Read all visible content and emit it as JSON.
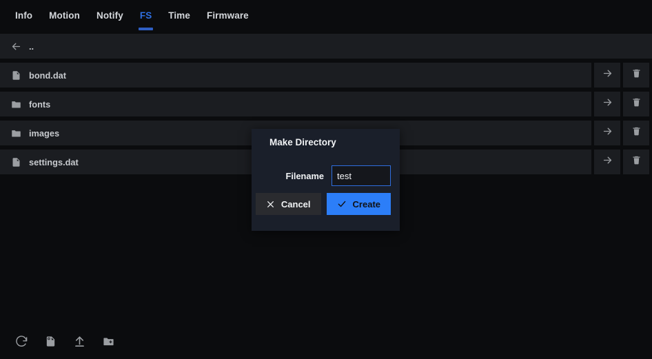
{
  "tabs": [
    {
      "label": "Info",
      "active": false
    },
    {
      "label": "Motion",
      "active": false
    },
    {
      "label": "Notify",
      "active": false
    },
    {
      "label": "FS",
      "active": true
    },
    {
      "label": "Time",
      "active": false
    },
    {
      "label": "Firmware",
      "active": false
    }
  ],
  "filelist": {
    "rows": [
      {
        "name": "..",
        "icon": "back-arrow-icon",
        "type": "parent",
        "actions": false
      },
      {
        "name": "bond.dat",
        "icon": "file-icon",
        "type": "file",
        "actions": true
      },
      {
        "name": "fonts",
        "icon": "folder-icon",
        "type": "folder",
        "actions": true
      },
      {
        "name": "images",
        "icon": "folder-icon",
        "type": "folder",
        "actions": true
      },
      {
        "name": "settings.dat",
        "icon": "file-icon",
        "type": "file",
        "actions": true
      }
    ],
    "action_icons": {
      "open": "arrow-right-icon",
      "delete": "trash-icon"
    }
  },
  "toolbar": {
    "buttons": [
      {
        "icon": "refresh-icon",
        "name": "refresh-button"
      },
      {
        "icon": "new-file-icon",
        "name": "new-file-button"
      },
      {
        "icon": "upload-icon",
        "name": "upload-button"
      },
      {
        "icon": "new-folder-icon",
        "name": "new-folder-button"
      }
    ]
  },
  "modal": {
    "title": "Make Directory",
    "filename_label": "Filename",
    "filename_value": "test",
    "filename_placeholder": "",
    "cancel_label": "Cancel",
    "create_label": "Create",
    "cancel_icon": "close-x-icon",
    "create_icon": "check-icon"
  },
  "colors": {
    "page_bg": "#0b0c0e",
    "row_bg": "#1b1d21",
    "accent_blue": "#2f6fe0",
    "button_blue": "#2c7ef8",
    "modal_bg": "#1a1f2a",
    "text_primary": "#f1f3f5",
    "text_secondary": "#c6c9cd",
    "icon_gray": "#9b9ea2"
  }
}
